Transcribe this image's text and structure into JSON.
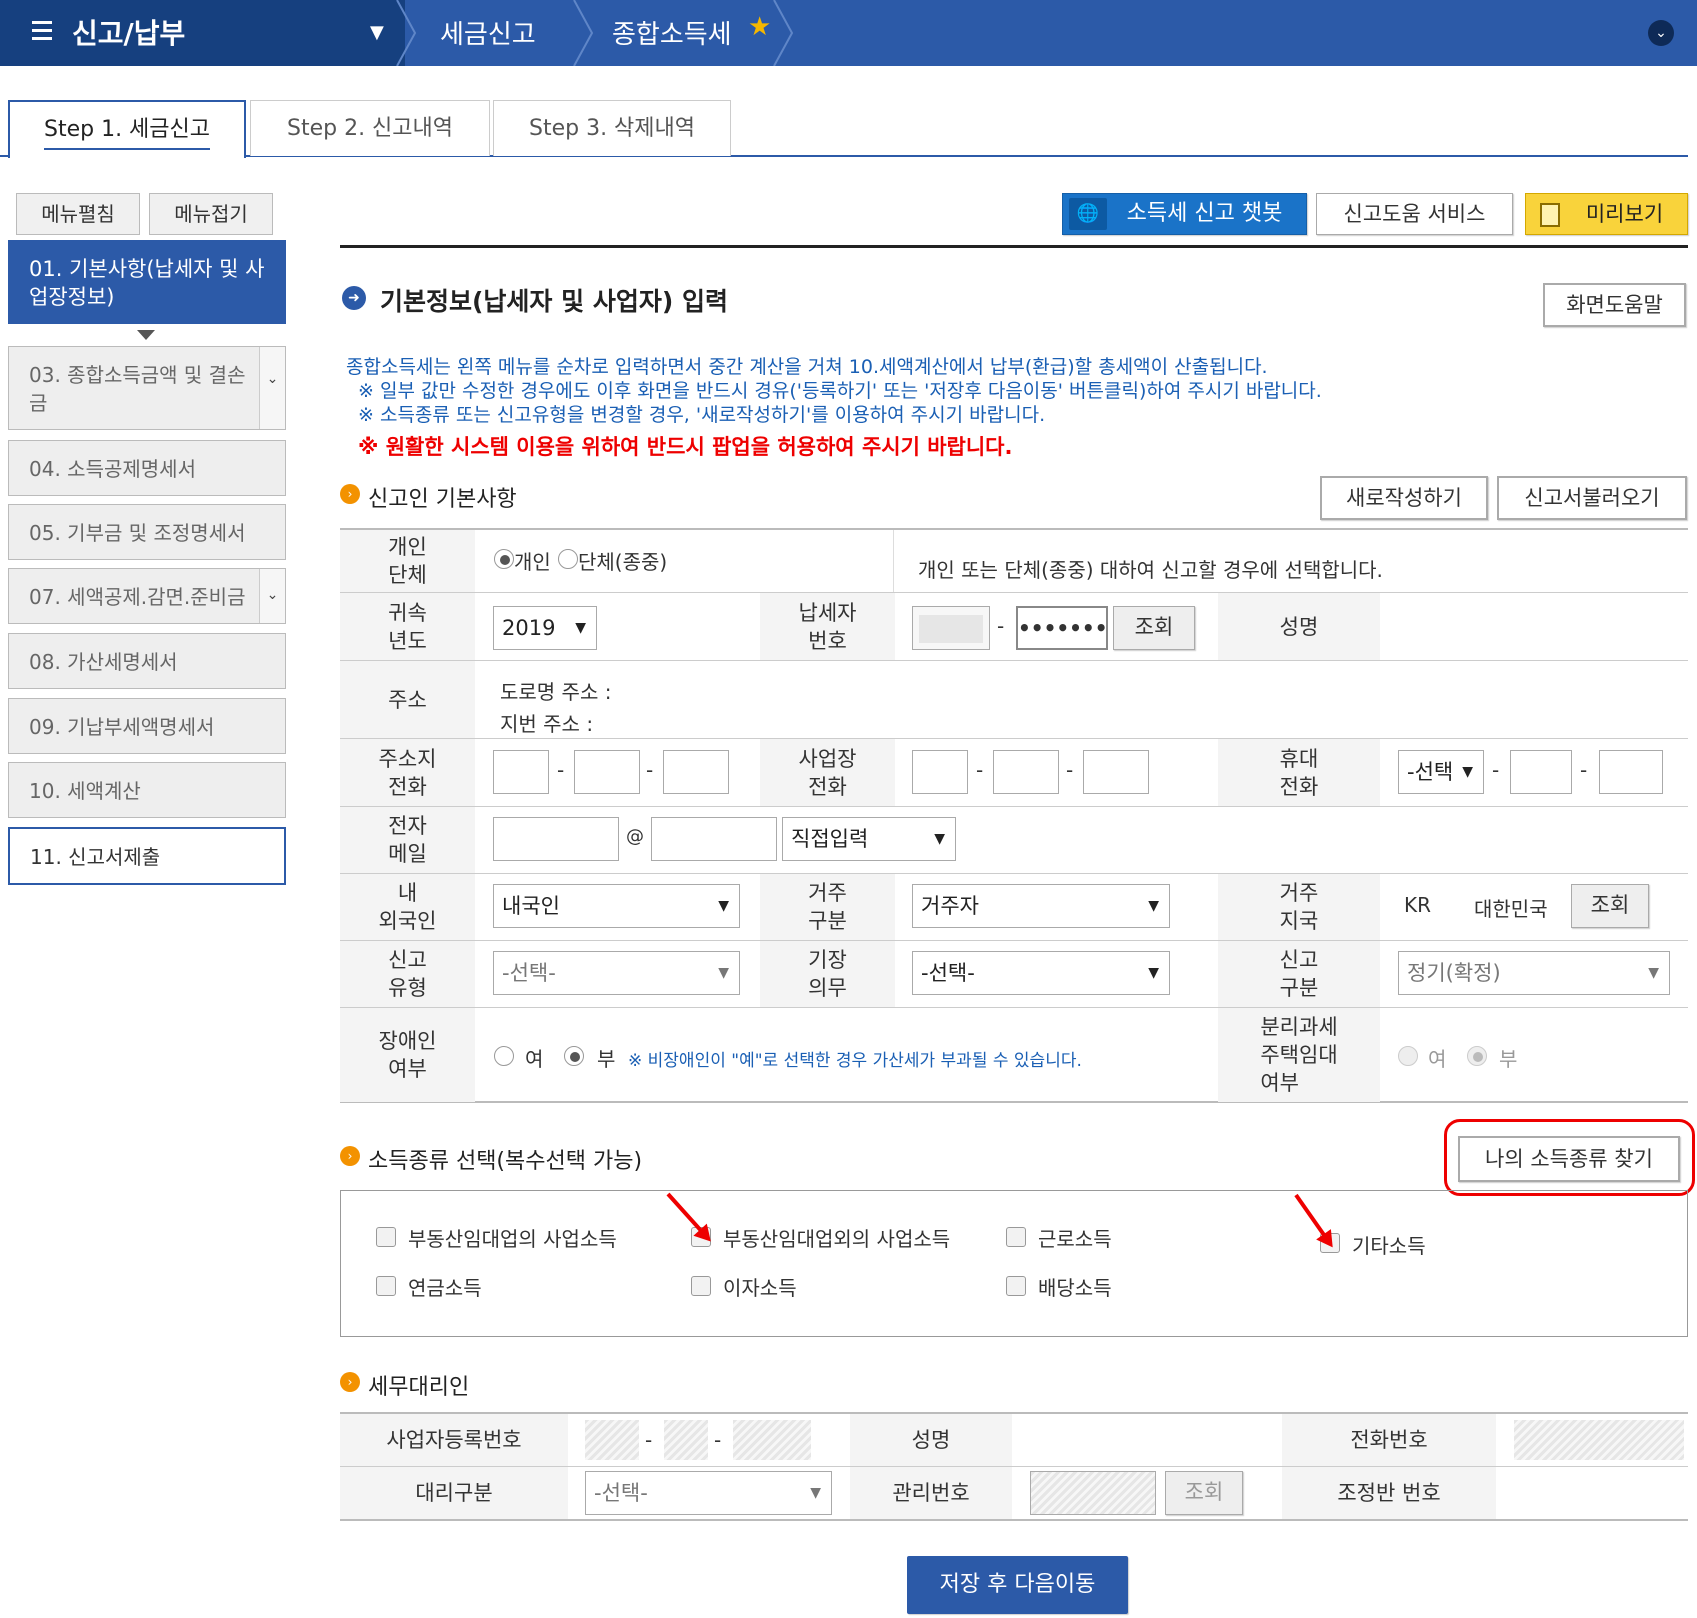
{
  "topbar": {
    "title": "신고/납부",
    "crumb1": "세금신고",
    "crumb2": "종합소득세"
  },
  "steps": [
    {
      "label": "Step 1. 세금신고"
    },
    {
      "label": "Step 2. 신고내역"
    },
    {
      "label": "Step 3. 삭제내역"
    }
  ],
  "sidebar": {
    "expand_label": "메뉴펼침",
    "collapse_label": "메뉴접기",
    "items": [
      {
        "label": "01. 기본사항(납세자 및 사업장정보)"
      },
      {
        "label": "03. 종합소득금액 및 결손금"
      },
      {
        "label": "04. 소득공제명세서"
      },
      {
        "label": "05. 기부금 및 조정명세서"
      },
      {
        "label": "07. 세액공제.감면.준비금"
      },
      {
        "label": "08. 가산세명세서"
      },
      {
        "label": "09. 기납부세액명세서"
      },
      {
        "label": "10. 세액계산"
      },
      {
        "label": "11. 신고서제출"
      }
    ]
  },
  "toolbar": {
    "chatbot_label": "소득세 신고 챗봇",
    "help_service_label": "신고도움 서비스",
    "preview_label": "미리보기"
  },
  "main": {
    "title": "기본정보(납세자 및 사업자) 입력",
    "screen_help_label": "화면도움말",
    "info1": "종합소득세는 왼쪽 메뉴를 순차로 입력하면서 중간 계산을 거쳐 10.세액계산에서 납부(환급)할 총세액이 산출됩니다.",
    "info2": "※ 일부 값만 수정한 경우에도 이후 화면을 반드시 경유('등록하기' 또는 '저장후 다음이동' 버튼클릭)하여 주시기 바랍니다.",
    "info3": "※ 소득종류 또는 신고유형을 변경할 경우, '새로작성하기'를 이용하여 주시기 바랍니다.",
    "warning": "※ 원활한 시스템 이용을 위하여 반드시 팝업을 허용하여 주시기 바랍니다."
  },
  "basic": {
    "section_title": "신고인 기본사항",
    "new_label": "새로작성하기",
    "load_label": "신고서불러오기",
    "type_label": "개인\n단체",
    "opt_individual": "개인",
    "opt_group": "단체(종중)",
    "type_desc": "개인 또는 단체(종중) 대하여 신고할 경우에 선택합니다.",
    "year_label": "귀속\n년도",
    "year_value": "2019",
    "taxpayer_no_label": "납세자\n번호",
    "taxpayer_no_masked": "•••••••",
    "lookup_label": "조회",
    "name_label": "성명",
    "address_label": "주소",
    "road_address": "도로명 주소 :",
    "lot_address": "지번 주소 :",
    "home_phone_label": "주소지\n전화",
    "biz_phone_label": "사업장\n전화",
    "mobile_label": "휴대\n전화",
    "mobile_select": "-선택",
    "email_label": "전자\n메일",
    "email_at": "@",
    "email_domain_select": "직접입력",
    "nationality_label": "내\n외국인",
    "nationality_value": "내국인",
    "residence_label": "거주\n구분",
    "residence_value": "거주자",
    "residence_country_label": "거주\n지국",
    "country_code": "KR",
    "country_name": "대한민국",
    "report_type_label": "신고\n유형",
    "report_type_value": "-선택-",
    "bookkeeping_label": "기장\n의무",
    "bookkeeping_value": "-선택-",
    "report_class_label": "신고\n구분",
    "report_class_value": "정기(확정)",
    "disabled_label": "장애인\n여부",
    "yes": "여",
    "no": "부",
    "disabled_note": "※ 비장애인이 \"예\"로 선택한 경우 가산세가 부과될 수 있습니다.",
    "separate_tax_label": "분리과세\n주택임대\n여부"
  },
  "income": {
    "section_title": "소득종류 선택(복수선택 가능)",
    "find_label": "나의 소득종류 찾기",
    "types": [
      {
        "label": "부동산임대업의 사업소득"
      },
      {
        "label": "부동산임대업외의 사업소득"
      },
      {
        "label": "근로소득"
      },
      {
        "label": "기타소득"
      },
      {
        "label": "연금소득"
      },
      {
        "label": "이자소득"
      },
      {
        "label": "배당소득"
      }
    ]
  },
  "agent": {
    "section_title": "세무대리인",
    "biz_no_label": "사업자등록번호",
    "name_label": "성명",
    "phone_label": "전화번호",
    "agent_type_label": "대리구분",
    "agent_type_value": "-선택-",
    "manage_no_label": "관리번호",
    "lookup_label": "조회",
    "team_no_label": "조정반 번호",
    "dash": "-"
  },
  "footer": {
    "save_next_label": "저장 후 다음이동"
  },
  "colors": {
    "brand_navy": "#16407f",
    "brand_blue": "#2c5aa8",
    "chatbot_blue": "#1a73c8",
    "preview_yellow": "#f9d33b",
    "warning_red": "#e00000",
    "accent_orange": "#f39200"
  }
}
